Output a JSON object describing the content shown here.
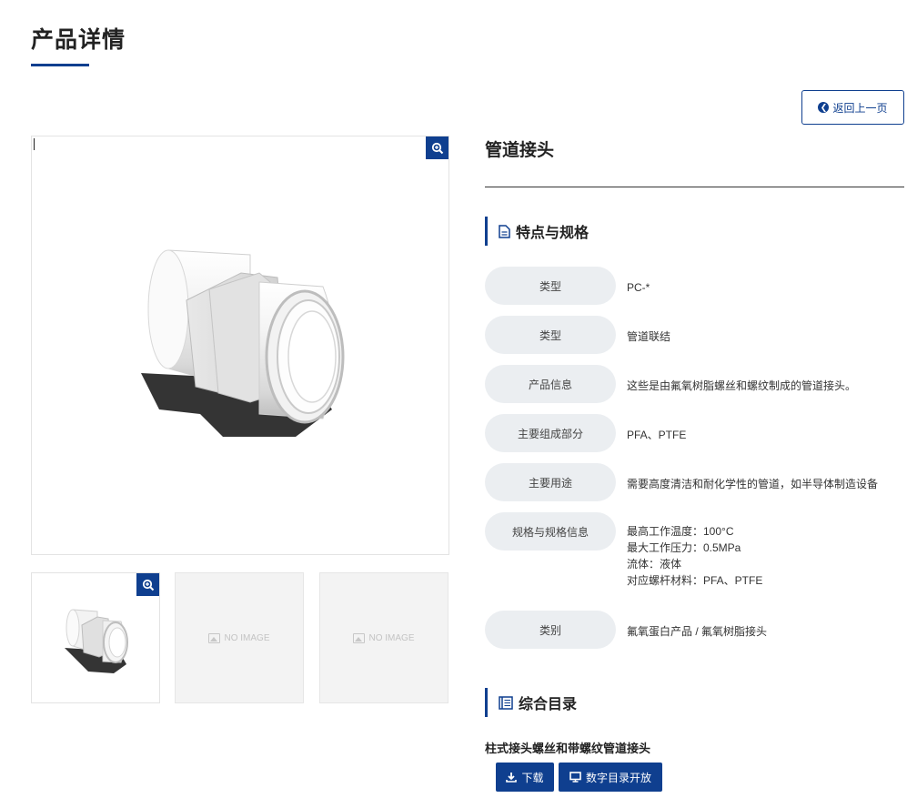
{
  "page": {
    "title": "产品详情"
  },
  "back_button": {
    "label": "返回上一页"
  },
  "gallery": {
    "thumbnails": [
      {
        "type": "image"
      },
      {
        "type": "placeholder",
        "label": "NO IMAGE"
      },
      {
        "type": "placeholder",
        "label": "NO IMAGE"
      }
    ]
  },
  "product": {
    "name": "管道接头"
  },
  "features": {
    "heading": "特点与规格",
    "rows": [
      {
        "label": "类型",
        "lines": [
          "PC-*"
        ]
      },
      {
        "label": "类型",
        "lines": [
          "管道联结"
        ]
      },
      {
        "label": "产品信息",
        "lines": [
          "这些是由氟氧树脂螺丝和螺纹制成的管道接头。"
        ]
      },
      {
        "label": "主要组成部分",
        "lines": [
          "PFA、PTFE"
        ]
      },
      {
        "label": "主要用途",
        "lines": [
          "需要高度清洁和耐化学性的管道，如半导体制造设备"
        ]
      },
      {
        "label": "规格与规格信息",
        "lines": [
          "最高工作温度：100°C",
          "最大工作压力：0.5MPa",
          "流体：液体",
          "对应螺杆材料：PFA、PTFE"
        ]
      },
      {
        "label": "类别",
        "lines": [
          "氟氧蛋白产品 / 氟氧树脂接头"
        ]
      }
    ]
  },
  "catalog": {
    "heading": "综合目录",
    "name": "柱式接头螺丝和带螺纹管道接头",
    "download_label": "下载",
    "digital_label": "数字目录开放"
  },
  "colors": {
    "accent": "#0f3f8f",
    "pill": "#ebeef1"
  },
  "icons": [
    "zoom-icon",
    "back-arrow-icon",
    "document-icon",
    "catalog-icon",
    "download-icon",
    "monitor-icon",
    "no-image-icon"
  ]
}
